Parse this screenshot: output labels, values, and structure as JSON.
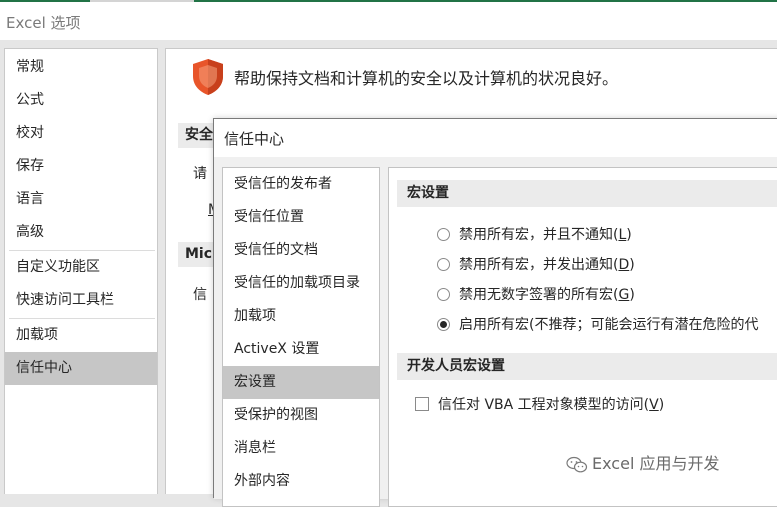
{
  "window": {
    "title": "Excel 选项"
  },
  "sidebar": {
    "items": [
      {
        "label": "常规"
      },
      {
        "label": "公式"
      },
      {
        "label": "校对"
      },
      {
        "label": "保存"
      },
      {
        "label": "语言"
      },
      {
        "label": "高级"
      },
      {
        "label": "自定义功能区"
      },
      {
        "label": "快速访问工具栏"
      },
      {
        "label": "加载项"
      },
      {
        "label": "信任中心"
      }
    ],
    "selected": "信任中心"
  },
  "main": {
    "help_text": "帮助保持文档和计算机的安全以及计算机的状况良好。",
    "section1_partial": "安全",
    "line1_partial": "请",
    "link_partial": "M",
    "section2_partial": "Mic",
    "line2_partial": "信"
  },
  "dialog": {
    "title": "信任中心",
    "nav": [
      {
        "label": "受信任的发布者"
      },
      {
        "label": "受信任位置"
      },
      {
        "label": "受信任的文档"
      },
      {
        "label": "受信任的加载项目录"
      },
      {
        "label": "加载项"
      },
      {
        "label": "ActiveX 设置"
      },
      {
        "label": "宏设置"
      },
      {
        "label": "受保护的视图"
      },
      {
        "label": "消息栏"
      },
      {
        "label": "外部内容"
      }
    ],
    "selected_nav": "宏设置",
    "macro_settings": {
      "heading": "宏设置",
      "options": [
        {
          "text": "禁用所有宏，并且不通知(",
          "key": "L",
          "suffix": ")",
          "checked": false
        },
        {
          "text": "禁用所有宏，并发出通知(",
          "key": "D",
          "suffix": ")",
          "checked": false
        },
        {
          "text": "禁用无数字签署的所有宏(",
          "key": "G",
          "suffix": ")",
          "checked": false
        },
        {
          "text": "启用所有宏(不推荐；可能会运行有潜在危险的代",
          "key": "",
          "suffix": "",
          "checked": true
        }
      ]
    },
    "developer_settings": {
      "heading": "开发人员宏设置",
      "checkbox_text": "信任对 VBA 工程对象模型的访问(",
      "checkbox_key": "V",
      "checkbox_suffix": ")",
      "checked": false
    }
  },
  "watermark": {
    "text": "Excel 应用与开发",
    "icon": "wechat-icon"
  },
  "colors": {
    "accent": "#217346",
    "selected_bg": "#c6c6c6",
    "shield": "#e8552a"
  }
}
